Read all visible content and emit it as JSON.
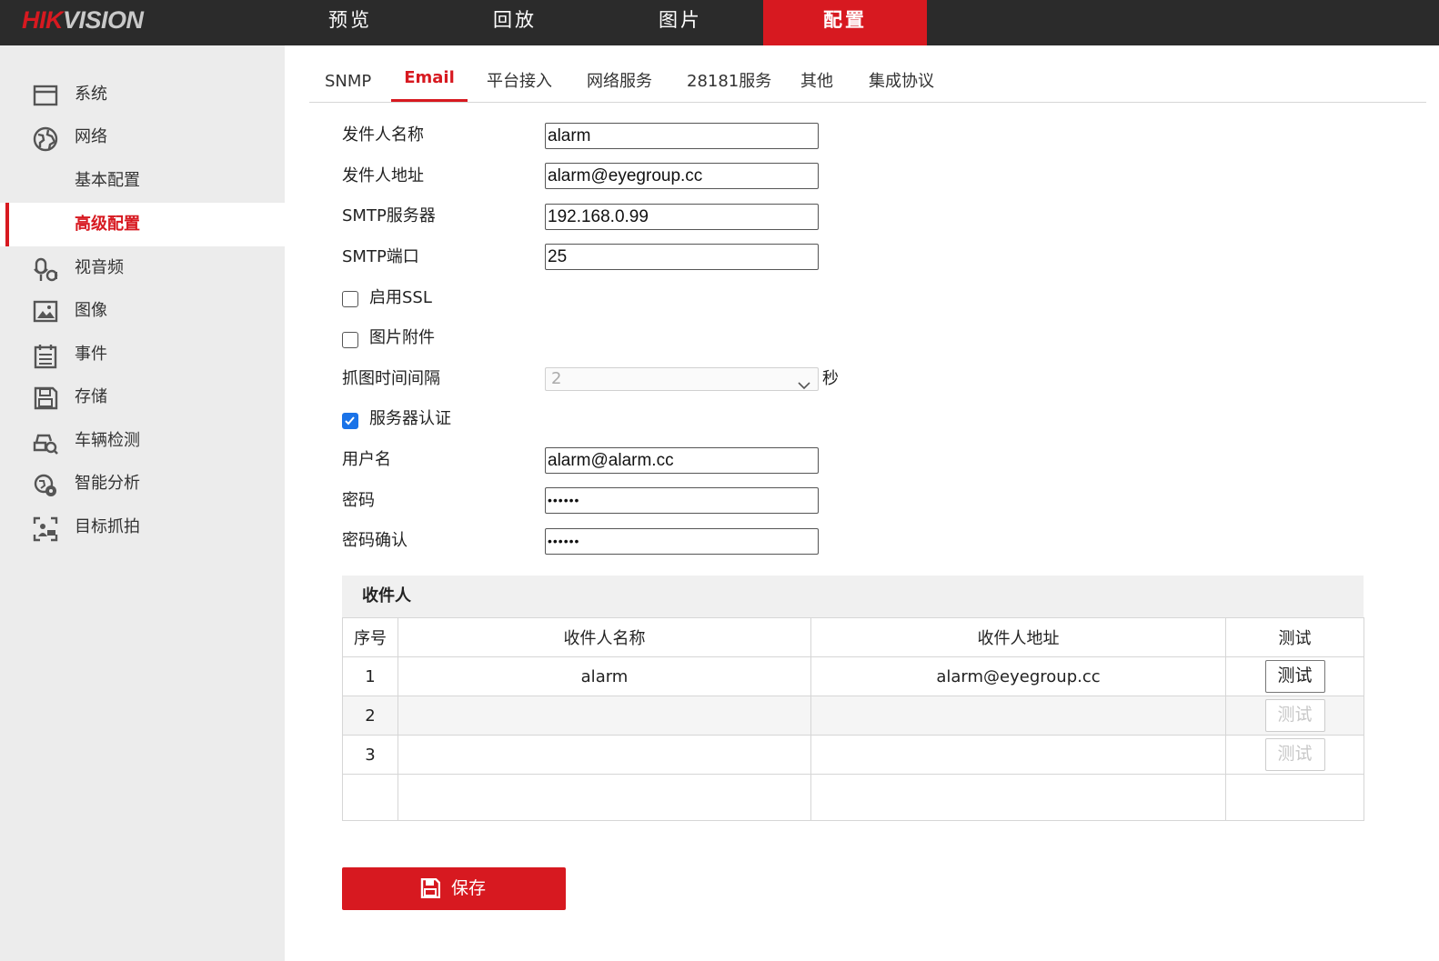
{
  "brand": {
    "logo_hik": "HIK",
    "logo_vision": "VISION",
    "accent": "#d71920"
  },
  "nav": [
    {
      "label": "预览",
      "active": false
    },
    {
      "label": "回放",
      "active": false
    },
    {
      "label": "图片",
      "active": false
    },
    {
      "label": "配置",
      "active": true
    }
  ],
  "sidebar": {
    "items": [
      {
        "label": "系统",
        "icon": "system-icon"
      },
      {
        "label": "网络",
        "icon": "network-icon"
      },
      {
        "label": "视音频",
        "icon": "video-audio-icon"
      },
      {
        "label": "图像",
        "icon": "image-icon"
      },
      {
        "label": "事件",
        "icon": "event-icon"
      },
      {
        "label": "存储",
        "icon": "storage-icon"
      },
      {
        "label": "车辆检测",
        "icon": "vehicle-detection-icon"
      },
      {
        "label": "智能分析",
        "icon": "smart-analysis-icon"
      },
      {
        "label": "目标抓拍",
        "icon": "target-capture-icon"
      }
    ],
    "sub_items": [
      {
        "label": "基本配置",
        "active": false
      },
      {
        "label": "高级配置",
        "active": true
      }
    ]
  },
  "tabs": [
    {
      "label": "SNMP",
      "active": false
    },
    {
      "label": "Email",
      "active": true
    },
    {
      "label": "平台接入",
      "active": false
    },
    {
      "label": "网络服务",
      "active": false
    },
    {
      "label": "28181服务",
      "active": false
    },
    {
      "label": "其他",
      "active": false
    },
    {
      "label": "集成协议",
      "active": false
    }
  ],
  "form": {
    "sender_name": {
      "label": "发件人名称",
      "value": "alarm"
    },
    "sender_address": {
      "label": "发件人地址",
      "value": "alarm@eyegroup.cc"
    },
    "smtp_server": {
      "label": "SMTP服务器",
      "value": "192.168.0.99"
    },
    "smtp_port": {
      "label": "SMTP端口",
      "value": "25"
    },
    "enable_ssl": {
      "label": "启用SSL",
      "checked": false
    },
    "attach_image": {
      "label": "图片附件",
      "checked": false
    },
    "capture_interval": {
      "label": "抓图时间间隔",
      "value": "2",
      "unit": "秒",
      "disabled": true
    },
    "server_auth": {
      "label": "服务器认证",
      "checked": true
    },
    "username": {
      "label": "用户名",
      "value": "alarm@alarm.cc"
    },
    "password": {
      "label": "密码",
      "value": "••••••"
    },
    "password_confirm": {
      "label": "密码确认",
      "value": "••••••"
    }
  },
  "recipients": {
    "title": "收件人",
    "columns": [
      "序号",
      "收件人名称",
      "收件人地址",
      "测试"
    ],
    "rows": [
      {
        "index": "1",
        "name": "alarm",
        "address": "alarm@eyegroup.cc",
        "test_label": "测试",
        "test_enabled": true
      },
      {
        "index": "2",
        "name": "",
        "address": "",
        "test_label": "测试",
        "test_enabled": false
      },
      {
        "index": "3",
        "name": "",
        "address": "",
        "test_label": "测试",
        "test_enabled": false
      }
    ]
  },
  "save": {
    "label": "保存",
    "icon": "save-icon"
  }
}
